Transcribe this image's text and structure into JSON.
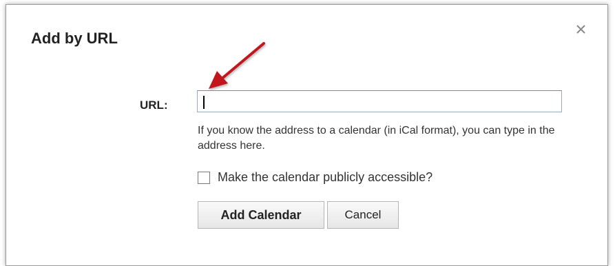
{
  "dialog": {
    "title": "Add by URL",
    "close_icon": "close-x-icon",
    "url_label": "URL:",
    "url_value": "",
    "help_text": "If you know the address to a calendar (in iCal format), you can type in the address here.",
    "public_checkbox": {
      "label": "Make the calendar publicly accessible?",
      "checked": false
    },
    "buttons": {
      "add_label": "Add Calendar",
      "cancel_label": "Cancel"
    }
  },
  "annotation": {
    "arrow_icon": "red-arrow-icon",
    "arrow_color": "#c0191e"
  }
}
